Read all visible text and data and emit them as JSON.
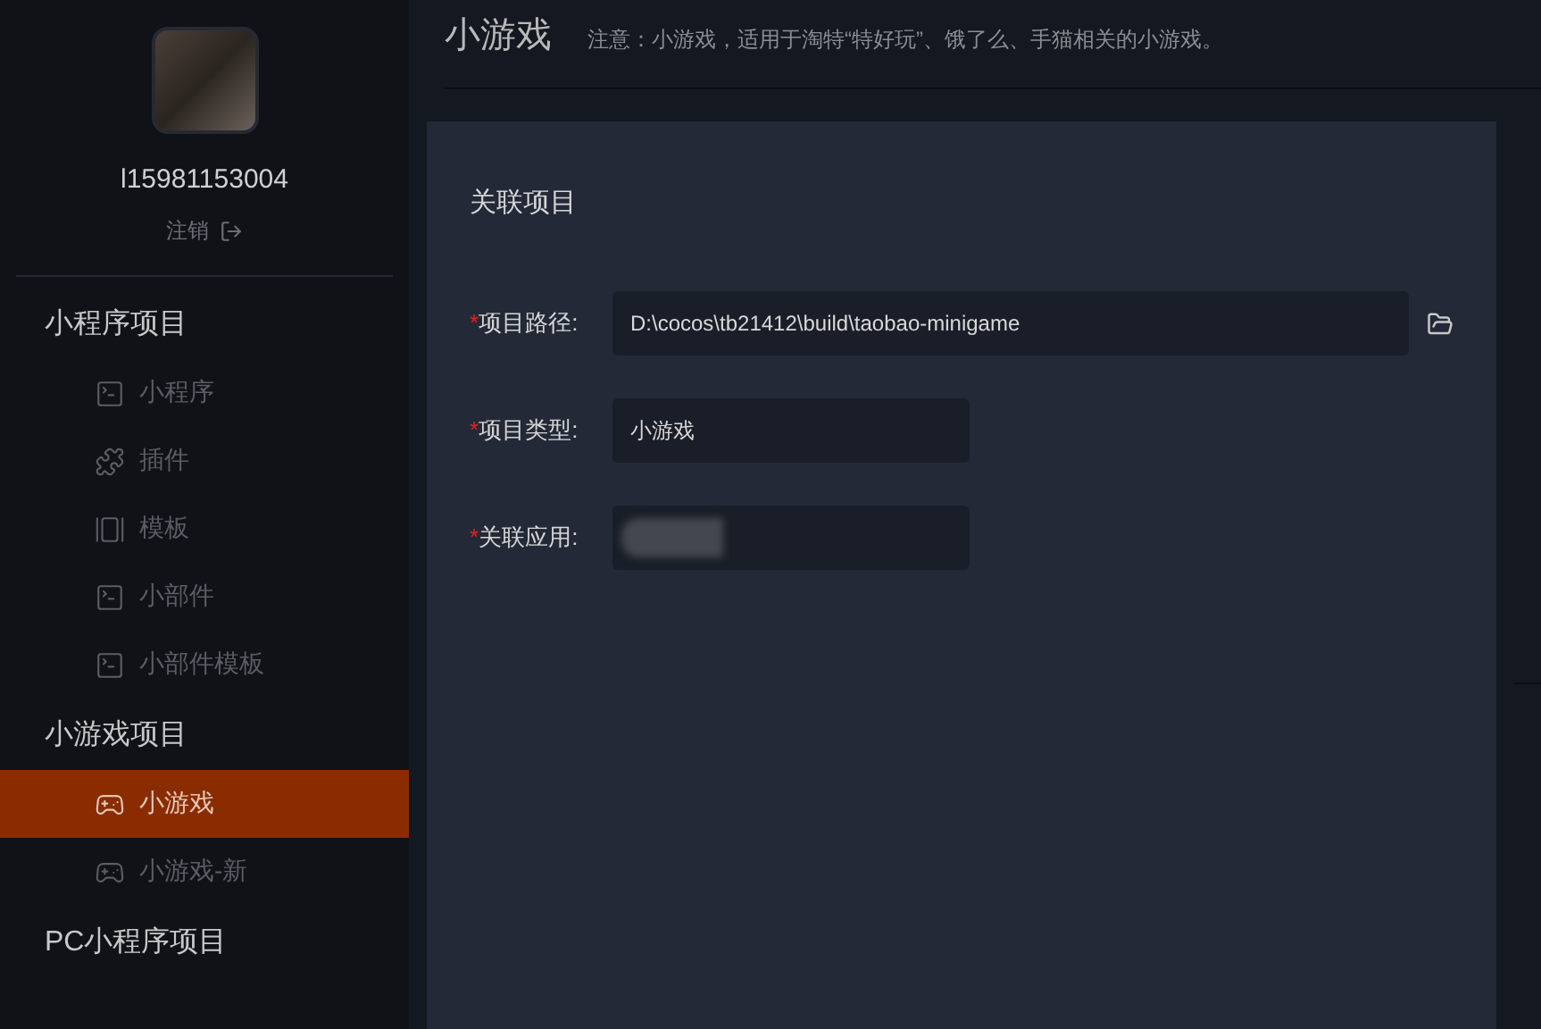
{
  "sidebar": {
    "user": {
      "name": "l15981153004",
      "logout": "注销"
    },
    "sections": [
      {
        "title": "小程序项目",
        "items": [
          {
            "label": "小程序",
            "kind": "terminal",
            "selected": false
          },
          {
            "label": "插件",
            "kind": "puzzle",
            "selected": false
          },
          {
            "label": "模板",
            "kind": "template",
            "selected": false
          },
          {
            "label": "小部件",
            "kind": "terminal",
            "selected": false
          },
          {
            "label": "小部件模板",
            "kind": "terminal",
            "selected": false
          }
        ]
      },
      {
        "title": "小游戏项目",
        "items": [
          {
            "label": "小游戏",
            "kind": "gamepad",
            "selected": true
          },
          {
            "label": "小游戏-新",
            "kind": "gamepad",
            "selected": false
          }
        ]
      },
      {
        "title": "PC小程序项目"
      }
    ]
  },
  "header": {
    "title": "小游戏",
    "note": "注意：小游戏，适用于淘特“特好玩”、饿了么、手猫相关的小游戏。"
  },
  "dialog": {
    "title": "关联项目",
    "fields": [
      {
        "label": "项目路径:",
        "required_mark": "*",
        "kind": "text",
        "value": "D:\\cocos\\tb21412\\build\\taobao-minigame",
        "browse": true
      },
      {
        "label": "项目类型:",
        "required_mark": "*",
        "kind": "text",
        "value": "小游戏",
        "browse": false
      },
      {
        "label": "关联应用:",
        "required_mark": "*",
        "kind": "blurred",
        "browse": false
      }
    ]
  }
}
